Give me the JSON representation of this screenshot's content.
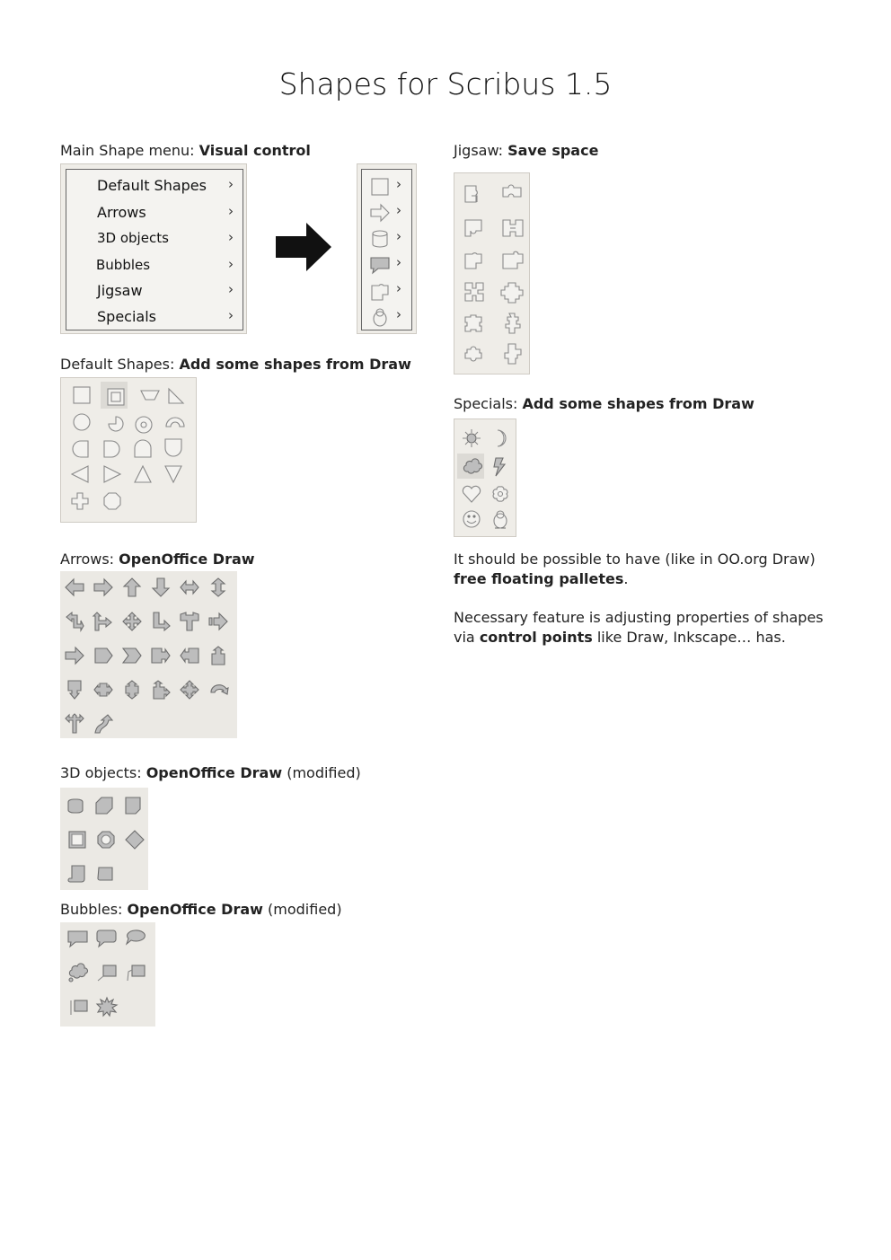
{
  "page": {
    "title": "Shapes for Scribus 1.5"
  },
  "sections": {
    "main_menu": {
      "label": "Main Shape menu: ",
      "bold": "Visual control"
    },
    "default_shapes": {
      "label": "Default Shapes: ",
      "bold": "Add some shapes from Draw"
    },
    "arrows": {
      "label": "Arrows: ",
      "bold": "OpenOffice Draw"
    },
    "objects3d": {
      "label": "3D objects: ",
      "bold": "OpenOffice Draw",
      "suffix": " (modified)"
    },
    "bubbles": {
      "label": "Bubbles: ",
      "bold": "OpenOffice Draw",
      "suffix": " (modified)"
    },
    "jigsaw": {
      "label": "Jigsaw: ",
      "bold": "Save space"
    },
    "specials": {
      "label": "Specials: ",
      "bold": "Add some shapes from Draw"
    }
  },
  "menu": {
    "items": [
      "Default Shapes",
      "Arrows",
      "3D objects",
      "Bubbles",
      "Jigsaw",
      "Specials"
    ],
    "chevron": "›"
  },
  "notes": {
    "p1_before": "It should be possible to have (like in OO.org Draw) ",
    "p1_bold": "free floating palletes",
    "p1_after": ".",
    "p2_before": "Necessary feature is adjusting properties of shapes via ",
    "p2_bold": "control points",
    "p2_after": " like Draw, Inkscape… has."
  },
  "icons": {
    "menu_icons": [
      "rectangle-icon",
      "arrow-right-icon",
      "cylinder-icon",
      "speech-bubble-icon",
      "jigsaw-piece-icon",
      "penguin-icon"
    ],
    "big_arrow": "big-arrow-right-icon"
  }
}
